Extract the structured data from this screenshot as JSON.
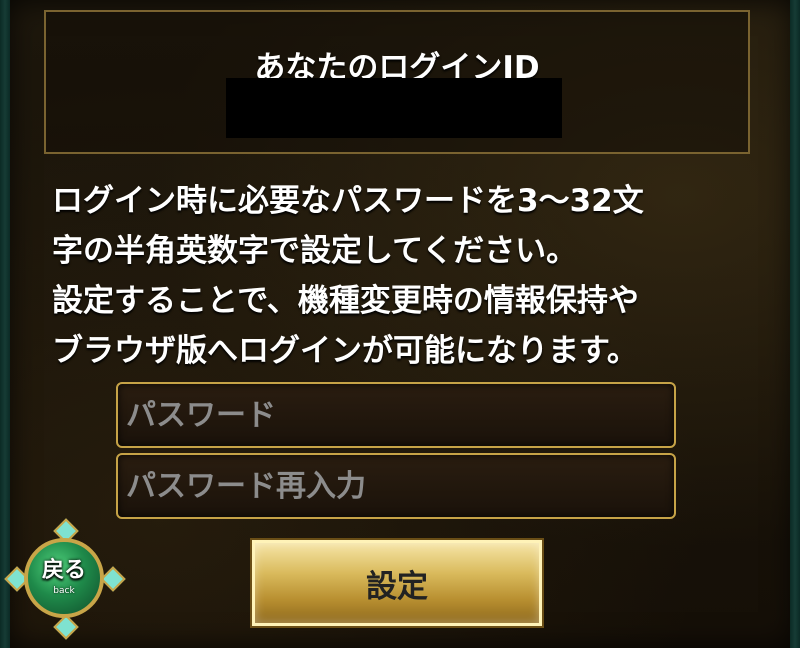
{
  "login_id": {
    "title": "あなたのログインID",
    "value": ""
  },
  "description": {
    "lines": [
      "ログイン時に必要なパスワードを3〜32文",
      "字の半角英数字で設定してください。",
      "設定することで、機種変更時の情報保持や",
      "ブラウザ版へログインが可能になります。"
    ]
  },
  "form": {
    "password_placeholder": "パスワード",
    "password_confirm_placeholder": "パスワード再入力",
    "submit_label": "設定"
  },
  "back_button": {
    "label": "戻る",
    "sublabel": "back"
  },
  "colors": {
    "gold_border": "#c6a347",
    "panel_border": "#7a6330",
    "back_green": "#1f8a4a",
    "button_gold": "#d9ba5c"
  }
}
